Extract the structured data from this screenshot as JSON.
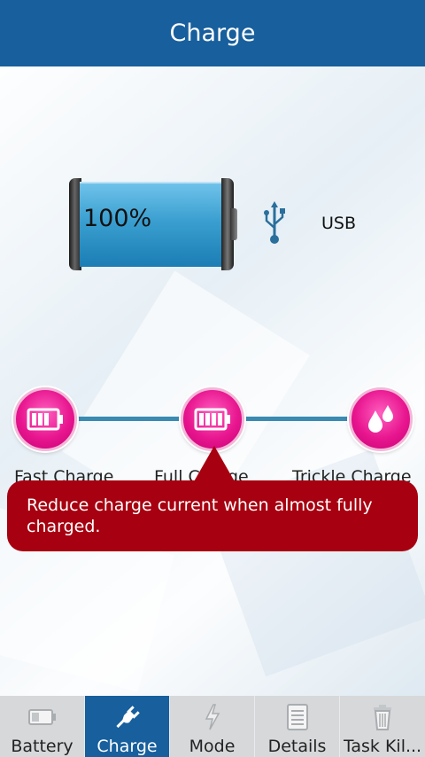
{
  "header": {
    "title": "Charge"
  },
  "battery": {
    "percent": "100%",
    "source": "USB"
  },
  "modes": [
    {
      "label": "Fast Charge",
      "icon": "battery-half-icon"
    },
    {
      "label": "Full Charge",
      "icon": "battery-full-icon"
    },
    {
      "label": "Trickle Charge",
      "icon": "droplets-icon"
    }
  ],
  "tooltip": {
    "text": "Reduce charge current when almost fully charged."
  },
  "nav": {
    "tabs": [
      {
        "label": "Battery",
        "icon": "battery-icon",
        "active": false
      },
      {
        "label": "Charge",
        "icon": "plug-icon",
        "active": true
      },
      {
        "label": "Mode",
        "icon": "lightning-icon",
        "active": false
      },
      {
        "label": "Details",
        "icon": "document-icon",
        "active": false
      },
      {
        "label": "Task Kil...",
        "icon": "trash-icon",
        "active": false
      }
    ]
  },
  "colors": {
    "header": "#175f9d",
    "accent_pink": "#e8168f",
    "tooltip_red": "#a70010",
    "nav_bg": "#d6d8da"
  }
}
